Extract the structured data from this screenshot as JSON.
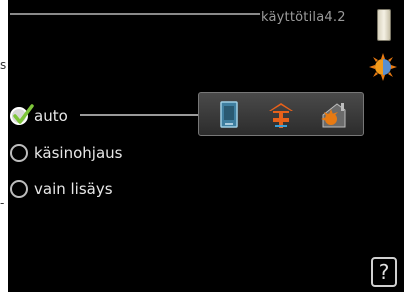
{
  "header": {
    "title": "käyttötila4.2"
  },
  "options": [
    {
      "label": "auto",
      "selected": true
    },
    {
      "label": "käsinohjaus",
      "selected": false
    },
    {
      "label": "vain lisäys",
      "selected": false
    }
  ],
  "mode_icons": [
    "heating-unit-icon",
    "addition-heat-icon",
    "house-heating-icon"
  ],
  "side_icon": "sun-globe-icon",
  "help": {
    "label": "?"
  },
  "colors": {
    "background": "#000000",
    "text": "#e8e8e8",
    "accent_check": "#7ec63a"
  }
}
